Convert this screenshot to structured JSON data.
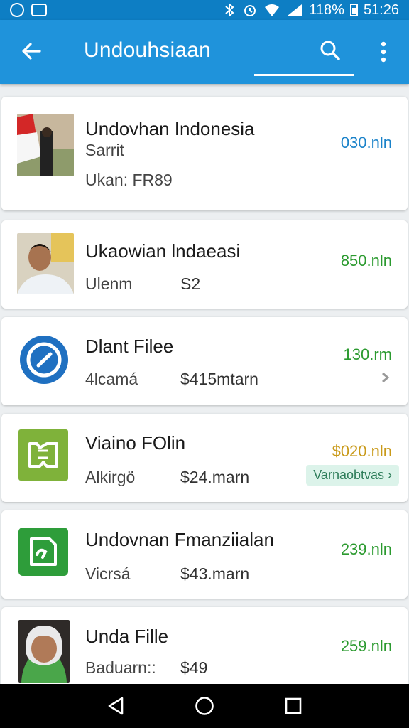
{
  "status_bar": {
    "battery": "118%",
    "time": "51:26"
  },
  "app_bar": {
    "title": "Undouhsiaan"
  },
  "colors": {
    "primary": "#1f93db",
    "status": "#0d7ec4",
    "blue_price": "#1a82c9",
    "green_price": "#2b9a2f",
    "orange_price": "#c99a1a"
  },
  "items": [
    {
      "name": "Undovhan Indonesia",
      "sub": "Sarrit",
      "detail": "Ukan: FR89",
      "price": "030.nln",
      "icon": "flag-photo"
    },
    {
      "name": "Ukaowian lndaeasi",
      "sub": "Ulenm",
      "amount": "S2",
      "price": "850.nln",
      "icon": "person-photo"
    },
    {
      "name": "Dlant Filee",
      "sub": "4lcamá",
      "amount": "$415mtarn",
      "price": "130.rm",
      "icon": "compass-icon"
    },
    {
      "name": "Viaino FOlin",
      "sub": "Alkirgö",
      "amount": "$24.marn",
      "price": "$020.nln",
      "tag": "Varnaobtvas",
      "icon": "book-icon"
    },
    {
      "name": "Undovnan Fmanziialan",
      "sub": "Vicrsá",
      "amount": "$43.marn",
      "price": "239.nln",
      "icon": "file-edit-icon"
    },
    {
      "name": "Unda Fille",
      "sub": "Baduarn::",
      "amount": "$49",
      "price": "259.nln",
      "icon": "person-hijab-photo"
    }
  ]
}
